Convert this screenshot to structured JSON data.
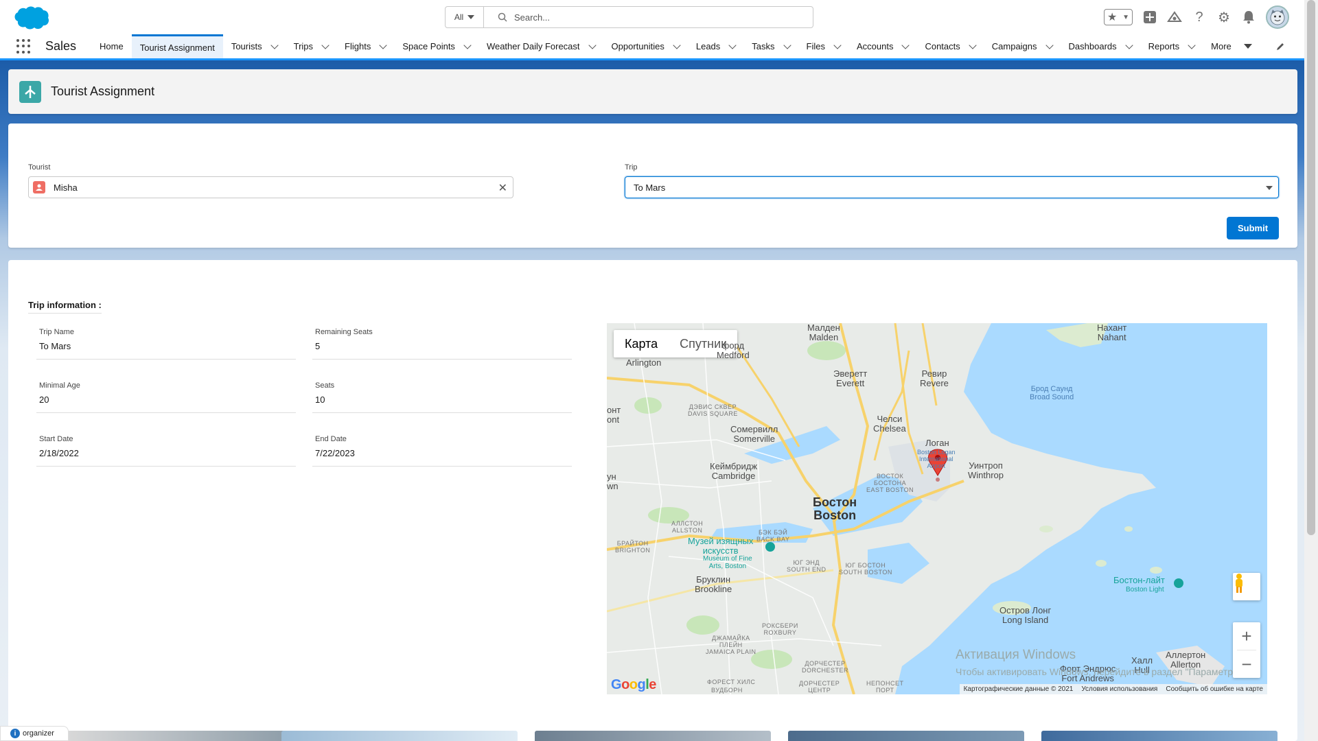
{
  "header": {
    "search_scope": "All",
    "search_placeholder": "Search..."
  },
  "nav": {
    "app_name": "Sales",
    "items": [
      {
        "label": "Home",
        "chevron": false
      },
      {
        "label": "Tourist Assignment",
        "chevron": false,
        "active": true
      },
      {
        "label": "Tourists",
        "chevron": true
      },
      {
        "label": "Trips",
        "chevron": true
      },
      {
        "label": "Flights",
        "chevron": true
      },
      {
        "label": "Space Points",
        "chevron": true
      },
      {
        "label": "Weather Daily Forecast",
        "chevron": true
      },
      {
        "label": "Opportunities",
        "chevron": true
      },
      {
        "label": "Leads",
        "chevron": true
      },
      {
        "label": "Tasks",
        "chevron": true
      },
      {
        "label": "Files",
        "chevron": true
      },
      {
        "label": "Accounts",
        "chevron": true
      },
      {
        "label": "Contacts",
        "chevron": true
      },
      {
        "label": "Campaigns",
        "chevron": true
      },
      {
        "label": "Dashboards",
        "chevron": true
      },
      {
        "label": "Reports",
        "chevron": true
      }
    ],
    "more_label": "More"
  },
  "page": {
    "title": "Tourist Assignment"
  },
  "form": {
    "tourist_label": "Tourist",
    "tourist_value": "Misha",
    "trip_label": "Trip",
    "trip_value": "To Mars",
    "submit_label": "Submit"
  },
  "trip_info": {
    "title": "Trip information :",
    "fields": [
      {
        "label": "Trip Name",
        "value": "To Mars"
      },
      {
        "label": "Remaining Seats",
        "value": "5"
      },
      {
        "label": "Minimal Age",
        "value": "20"
      },
      {
        "label": "Seats",
        "value": "10"
      },
      {
        "label": "Start Date",
        "value": "2/18/2022"
      },
      {
        "label": "End Date",
        "value": "7/22/2023"
      }
    ]
  },
  "map": {
    "tab_map": "Карта",
    "tab_satellite": "Спутник",
    "google": "Google",
    "attribution": [
      "Картографические данные © 2021",
      "Условия использования",
      "Сообщить об ошибке на карте"
    ],
    "labels": {
      "malden": "Малден\nMalden",
      "medford": "форд\nMedford",
      "arlington": "Arlington",
      "everett": "Эверетт\nEverett",
      "revere": "Ревир\nRevere",
      "nahant": "Нахант\nNahant",
      "broad_sound": "Брод Саунд\nBroad Sound",
      "davis": "ДЭВИС СКВЕР\nDAVIS SQUARE",
      "chelsea": "Челси\nChelsea",
      "somerville": "Сомервилл\nSomerville",
      "logan": "Логан",
      "logan_airport": "Boston Logan\nInternational\nAirport",
      "winthrop": "Уинтроп\nWinthrop",
      "cambridge": "Кеймбридж\nCambridge",
      "east_boston": "ВОСТОК\nБОСТОНА\nEAST BOSTON",
      "boston": "Бостон\nBoston",
      "allston": "АЛЛСТОН\nALLSTON",
      "back_bay": "БЭК БЭЙ\nBACK BAY",
      "brighton": "БРАЙТОН\nBRIGHTON",
      "mfa": "Музей изящных\nискусств",
      "mfa_en": "Museum of Fine\nArts, Boston",
      "south_end": "ЮГ ЭНД\nSOUTH END",
      "south_boston": "ЮГ БОСТОН\nSOUTH BOSTON",
      "brookline": "Бруклин\nBrookline",
      "boston_light": "Бостон-лайт",
      "boston_light_en": "Boston Light",
      "long_island": "Остров Лонг\nLong Island",
      "roxbury": "РОКСБЕРИ\nROXBURY",
      "jamaica_plain": "ДЖАМАЙКА\nПЛЕЙН\nJAMAICA PLAIN",
      "dorchester": "ДОРЧЕСТЕР\nDORCHESTER",
      "hull": "Халл\nHull",
      "allerton": "Аллертон\nAllerton",
      "fort_andrews": "Форт Эндрюс\nFort Andrews",
      "forest_hills": "ФОРЕСТ ХИЛС",
      "vudborn": "ВУДБОРН",
      "dorchester_center": "ДОРЧЕСТЕР\nЦЕНТР",
      "neponset": "НЕПОНСЕТ\nПОРТ",
      "left_ont": "онт\nont",
      "left_yn": "ун\nwn",
      "win_activate": "Активация Windows",
      "win_activate_sub": "Чтобы активировать Windows, перейдите в раздел \"Параметры\"."
    }
  },
  "organizer": {
    "label": "organizer"
  },
  "colors": {
    "brand_blue": "#0176d3",
    "nav_accent": "#1b96ff",
    "water": "#aadaff",
    "pin": "#ea4335"
  }
}
